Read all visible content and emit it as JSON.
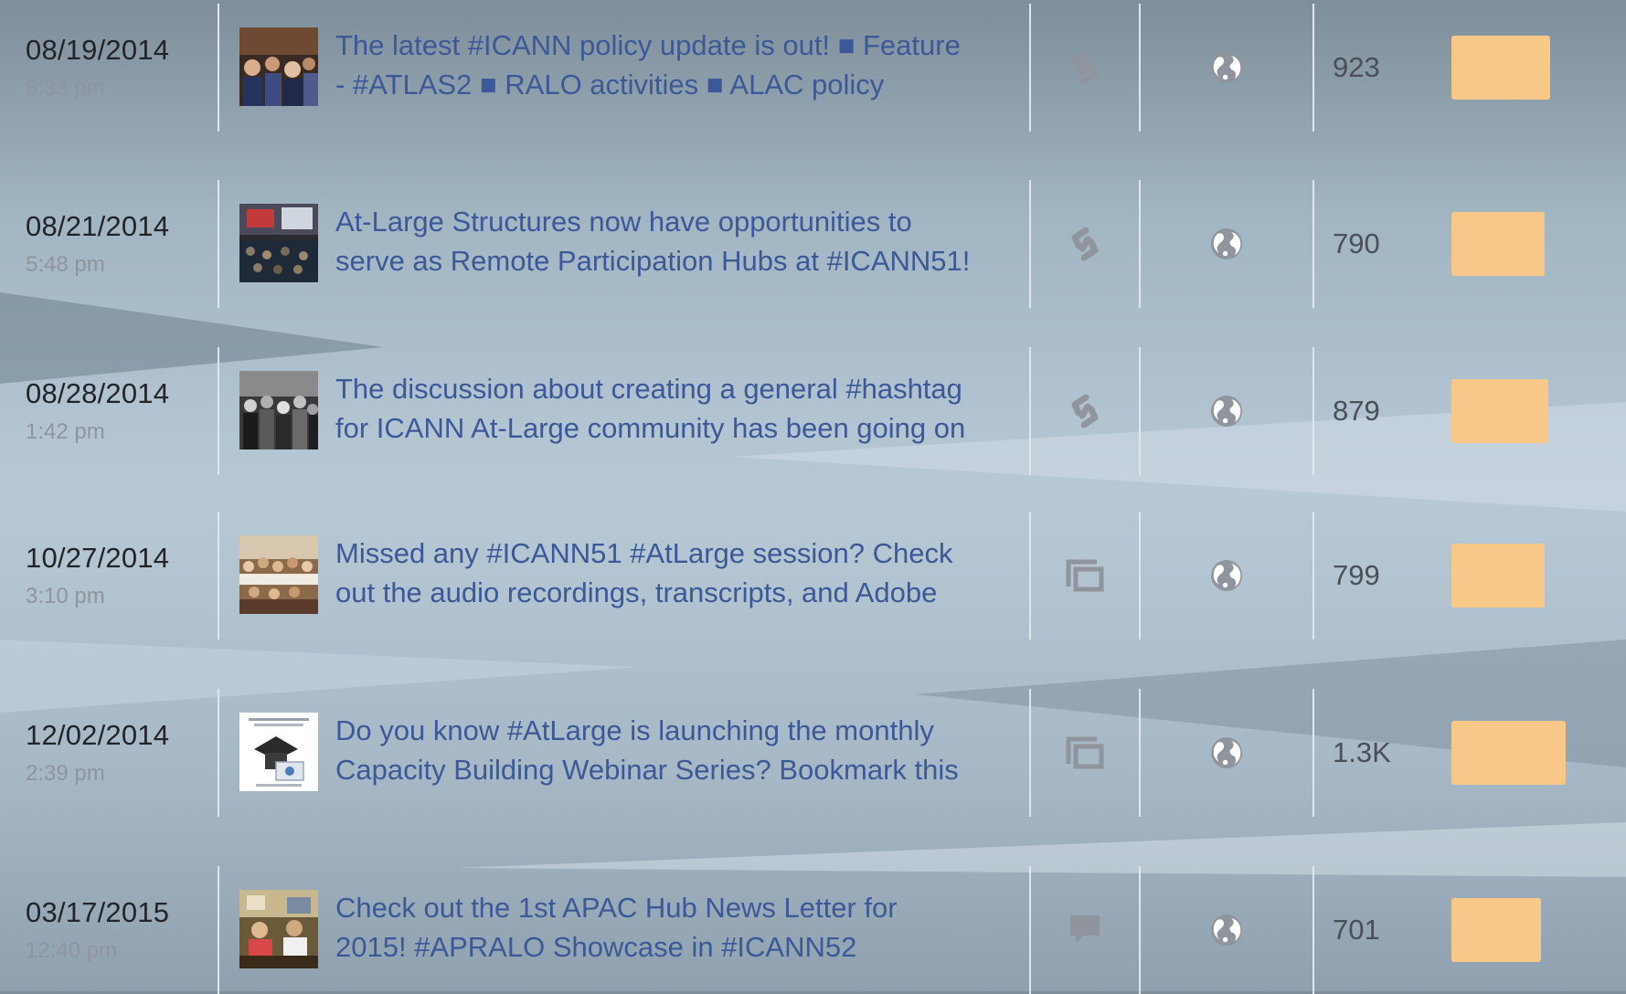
{
  "colors": {
    "link_text": "#3b5998",
    "date_text": "#222428",
    "time_text": "#90949c",
    "reach_bar": "#f8c888",
    "icon_gray": "#90949c"
  },
  "posts": [
    {
      "date": "08/19/2014",
      "time": "8:33 pm",
      "text": "The latest #ICANN policy update is out! ■ Feature\n- #ATLAS2 ■ RALO activities ■ ALAC policy",
      "type_icon": "link-icon",
      "visibility_icon": "globe-icon",
      "reach": "923",
      "reach_value": 923
    },
    {
      "date": "08/21/2014",
      "time": "5:48 pm",
      "text": "At-Large Structures now have opportunities to\nserve as Remote Participation Hubs at #ICANN51!",
      "type_icon": "link-icon",
      "visibility_icon": "globe-icon",
      "reach": "790",
      "reach_value": 790
    },
    {
      "date": "08/28/2014",
      "time": "1:42 pm",
      "text": "The discussion about creating a general #hashtag\nfor ICANN At-Large community has been going on",
      "type_icon": "link-icon",
      "visibility_icon": "globe-icon",
      "reach": "879",
      "reach_value": 879
    },
    {
      "date": "10/27/2014",
      "time": "3:10 pm",
      "text": "Missed any #ICANN51 #AtLarge session? Check\nout the audio recordings, transcripts, and Adobe",
      "type_icon": "album-icon",
      "visibility_icon": "globe-icon",
      "reach": "799",
      "reach_value": 799
    },
    {
      "date": "12/02/2014",
      "time": "2:39 pm",
      "text": "Do you know #AtLarge is launching the monthly\nCapacity Building Webinar Series? Bookmark this",
      "type_icon": "album-icon",
      "visibility_icon": "globe-icon",
      "reach": "1.3K",
      "reach_value": 1300
    },
    {
      "date": "03/17/2015",
      "time": "12:40 pm",
      "text": "Check out the 1st APAC Hub News Letter for\n2015! #APRALO Showcase in #ICANN52",
      "type_icon": "status-icon",
      "visibility_icon": "globe-icon",
      "reach": "701",
      "reach_value": 701
    }
  ]
}
